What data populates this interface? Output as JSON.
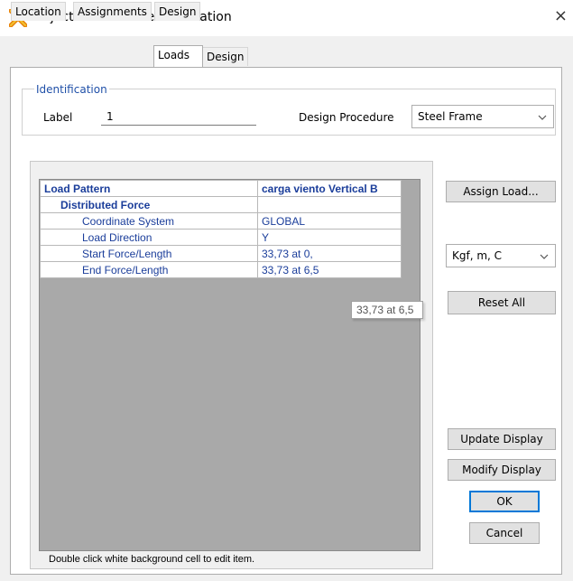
{
  "window": {
    "title": "Object Model - Line Information",
    "close_glyph": "×"
  },
  "tabs": [
    {
      "label": "Location",
      "active": false
    },
    {
      "label": "Assignments",
      "active": false
    },
    {
      "label": "Loads",
      "active": true
    },
    {
      "label": "Design",
      "active": false
    }
  ],
  "identification": {
    "group_label": "Identification",
    "label_caption": "Label",
    "label_value": "1",
    "design_procedure_caption": "Design Procedure",
    "design_procedure_value": "Steel Frame"
  },
  "grid": {
    "header": {
      "name": "Load Pattern",
      "value": "carga viento Vertical B"
    },
    "section": "Distributed Force",
    "rows": [
      {
        "name": "Coordinate System",
        "value": "GLOBAL"
      },
      {
        "name": "Load Direction",
        "value": "Y"
      },
      {
        "name": "Start Force/Length",
        "value": "33,73 at 0,"
      },
      {
        "name": "End Force/Length",
        "value": "33,73 at 6,5"
      }
    ],
    "tooltip": "33,73 at 6,5",
    "hint": "Double click white background cell to edit item."
  },
  "side": {
    "assign_load": "Assign Load...",
    "units_value": "Kgf, m, C",
    "reset_all": "Reset All",
    "update_display": "Update Display",
    "modify_display": "Modify Display",
    "ok": "OK",
    "cancel": "Cancel"
  },
  "icons": {
    "app": "sap-x-icon",
    "chevron": "chevron-down-icon",
    "close": "close-icon"
  },
  "colors": {
    "accent": "#0078d7",
    "grid_text": "#1a3d9a",
    "group_label": "#2050a8",
    "grid_background": "#a9a9a9"
  }
}
